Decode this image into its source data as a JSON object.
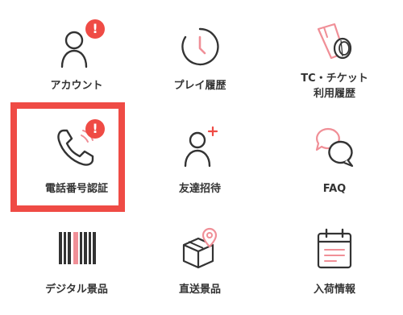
{
  "menu": {
    "items": [
      {
        "label": "アカウント",
        "icon": "user-icon",
        "alert": true
      },
      {
        "label": "プレイ履歴",
        "icon": "clock-icon",
        "alert": false
      },
      {
        "label": "TC・チケット\n利用履歴",
        "icon": "ticket-coin-icon",
        "alert": false
      },
      {
        "label": "電話番号認証",
        "icon": "phone-icon",
        "alert": true,
        "highlighted": true
      },
      {
        "label": "友達招待",
        "icon": "add-user-icon",
        "alert": false
      },
      {
        "label": "FAQ",
        "icon": "chat-bubbles-icon",
        "alert": false
      },
      {
        "label": "デジタル景品",
        "icon": "barcode-icon",
        "alert": false
      },
      {
        "label": "直送景品",
        "icon": "package-location-icon",
        "alert": false
      },
      {
        "label": "入荷情報",
        "icon": "calendar-icon",
        "alert": false
      }
    ],
    "alert_badge": "!"
  },
  "colors": {
    "accent": "#ef4b45",
    "pink": "#f08f97",
    "icon_stroke": "#333333",
    "text": "#333333"
  }
}
